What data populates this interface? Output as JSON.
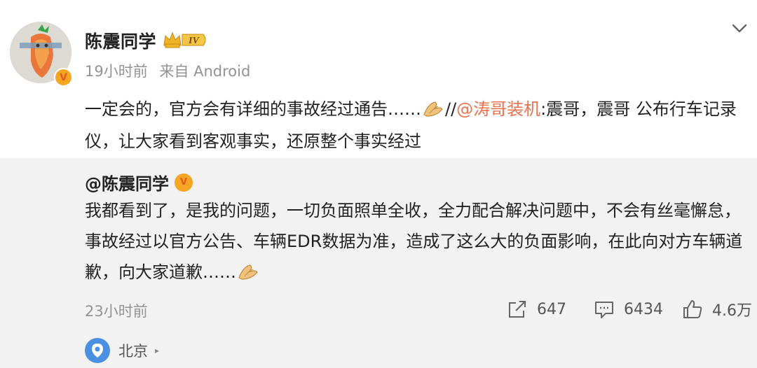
{
  "author": {
    "name": "陈震同学",
    "level_badge": "IV",
    "verified_badge": "V"
  },
  "meta": {
    "time": "19小时前",
    "source": "来自 Android"
  },
  "post": {
    "line_prefix": "一定会的，官方会有详细的事故经过通告……",
    "emoji": "folded-hands-icon",
    "repost_sep": "//",
    "mention": "@涛哥装机",
    "after_mention": ":震哥，震哥 公布行车记录仪，让大家看到客观事实，还原整个事实经过"
  },
  "repost": {
    "author": "@陈震同学",
    "text": "我都看到了，是我的问题，一切负面照单全收，全力配合解决问题中，不会有丝毫懈怠，事故经过以官方公告、车辆EDR数据为准，造成了这么大的负面影响，在此向对方车辆道歉，向大家道歉……",
    "time": "23小时前",
    "shares": "647",
    "comments": "6434",
    "likes": "4.6万",
    "location": "北京"
  },
  "colors": {
    "mention": "#eb7350",
    "repost_bg": "#f2f2f2",
    "meta_gray": "#939393",
    "badge_orange": "#f5a623",
    "pin_blue": "#4a90e2"
  }
}
